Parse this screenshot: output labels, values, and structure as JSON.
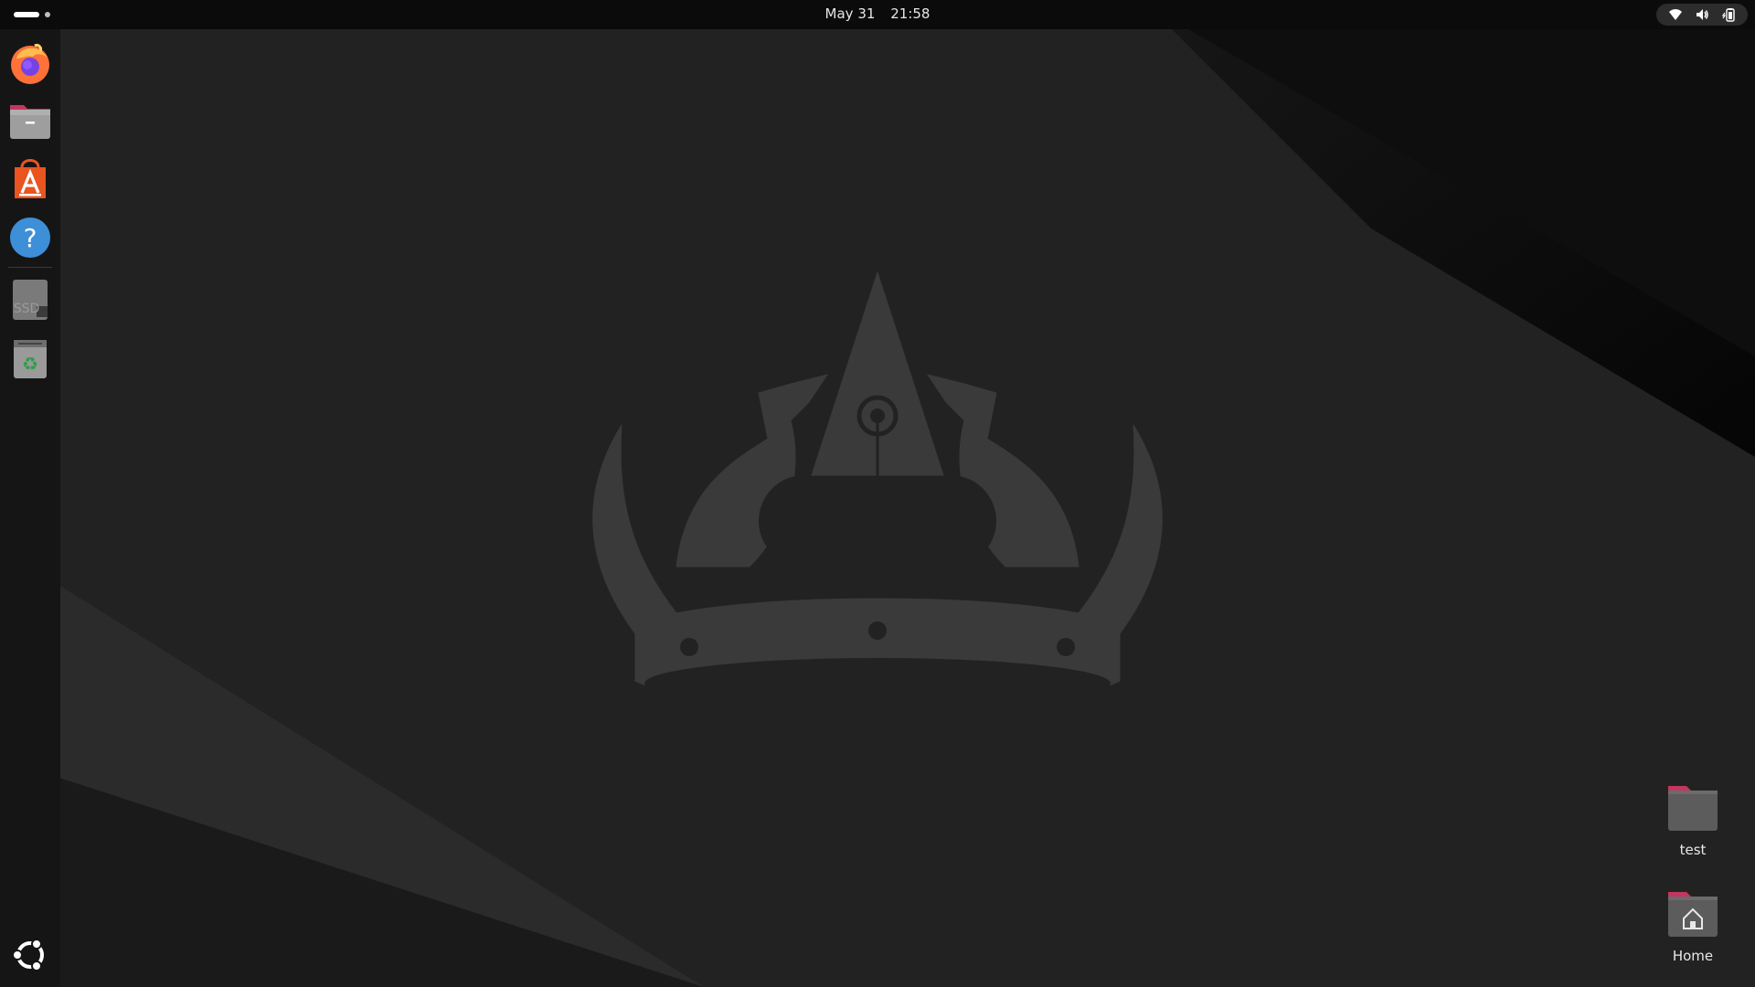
{
  "topbar": {
    "clock": {
      "date": "May 31",
      "time": "21:58"
    },
    "tray_icons": [
      "wifi-icon",
      "volume-icon",
      "battery-icon"
    ]
  },
  "dock": {
    "items": [
      {
        "name": "firefox",
        "icon": "firefox-icon"
      },
      {
        "name": "files",
        "icon": "files-folder-icon"
      },
      {
        "name": "app-center",
        "icon": "app-center-icon"
      },
      {
        "name": "help",
        "icon": "help-icon"
      },
      {
        "name": "disk",
        "icon": "ssd-drive-icon",
        "label": "SSD"
      },
      {
        "name": "trash",
        "icon": "trash-icon"
      }
    ],
    "show_apps_icon": "ubuntu-logo-icon"
  },
  "desktop_icons": [
    {
      "label": "test",
      "icon": "folder-icon"
    },
    {
      "label": "Home",
      "icon": "home-folder-icon"
    }
  ],
  "colors": {
    "accent": "#e95420",
    "topbar_bg": "#0b0b0b",
    "dock_bg": "#151515",
    "wallpaper_bg": "#202020",
    "crown": "#3a3a3a",
    "folder_tab": "#c4365f",
    "folder_body": "#5c5c5c"
  }
}
